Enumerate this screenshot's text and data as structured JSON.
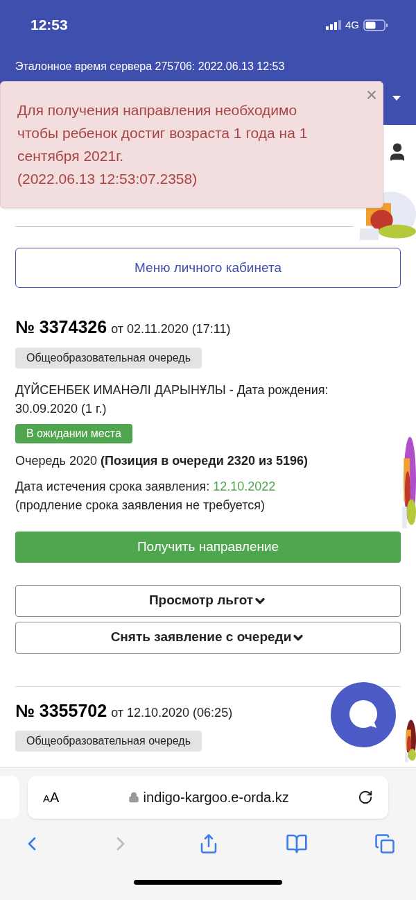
{
  "status_bar": {
    "time": "12:53",
    "network": "4G"
  },
  "header": {
    "server_time": "Эталонное время сервера 275706: 2022.06.13 12:53"
  },
  "alert": {
    "message": "Для получения направления необходимо чтобы ребенок достиг возраста 1 года на 1 сентября 2021г.",
    "timestamp": "(2022.06.13 12:53:07.2358)",
    "close": "×"
  },
  "menu_button": "Меню личного кабинета",
  "applications": [
    {
      "number": "№ 3374326",
      "date": "от 02.11.2020 (17:11)",
      "queue_type": "Общеобразовательная очередь",
      "child": "ДҮЙСЕНБЕК ИМАНӘЛІ ДАРЫНҰЛЫ - Дата рождения: 30.09.2020 (1 г.)",
      "status": "В ожидании места",
      "queue": "Очередь 2020 **(Позиция в очереди 2320 из 5196)**",
      "expiry_label": "Дата истечения срока заявления:",
      "expiry_date": "12.10.2022",
      "extension_note": "(продление срока заявления не требуется)",
      "actions": [
        {
          "kind": "primary",
          "label": "Получить направление"
        },
        {
          "kind": "dropdown",
          "label": "Просмотр льгот"
        },
        {
          "kind": "dropdown",
          "label": "Снять заявление с очереди"
        }
      ]
    },
    {
      "number": "№ 3355702",
      "date": "от 12.10.2020 (06:25)",
      "queue_type": "Общеобразовательная очередь"
    }
  ],
  "browser": {
    "text_size": "AA",
    "url": "indigo-kargoo.e-orda.kz"
  }
}
